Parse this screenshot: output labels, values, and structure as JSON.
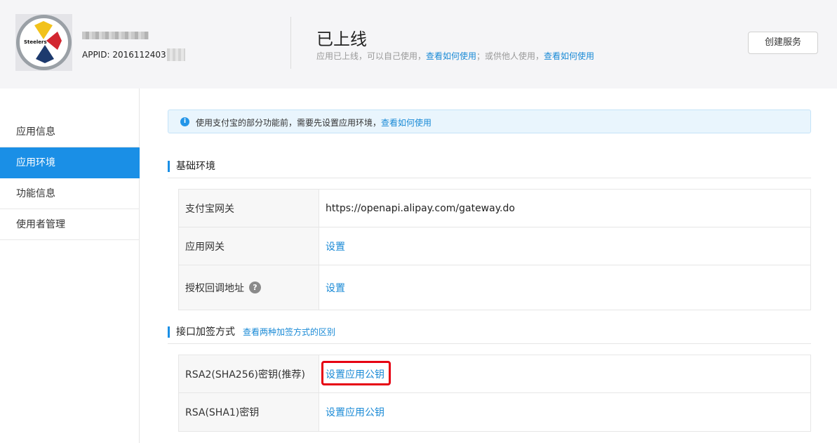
{
  "header": {
    "logo_text": "Steelers",
    "app_id_label": "APPID: 20161124031",
    "status_title": "已上线",
    "status_desc_pre": "应用已上线，可以自己使用，",
    "status_desc_link1": "查看如何使用",
    "status_desc_mid": "；或供他人使用，",
    "status_desc_link2": "查看如何使用",
    "create_button": "创建服务"
  },
  "sidebar": {
    "items": [
      {
        "label": "应用信息",
        "active": false
      },
      {
        "label": "应用环境",
        "active": true
      },
      {
        "label": "功能信息",
        "active": false
      },
      {
        "label": "使用者管理",
        "active": false
      }
    ]
  },
  "notice": {
    "icon": "info-icon",
    "text": "使用支付宝的部分功能前，需要先设置应用环境，",
    "link": "查看如何使用"
  },
  "basic_env": {
    "title": "基础环境",
    "rows": [
      {
        "label": "支付宝网关",
        "value": "https://openapi.alipay.com/gateway.do"
      },
      {
        "label": "应用网关",
        "value": "设置"
      },
      {
        "label": "授权回调地址",
        "help": "?",
        "value": "设置"
      }
    ]
  },
  "signing": {
    "title": "接口加签方式",
    "link": "查看两种加签方式的区别",
    "rows": [
      {
        "label": "RSA2(SHA256)密钥(推荐)",
        "value": "设置应用公钥"
      },
      {
        "label": "RSA(SHA1)密钥",
        "value": "设置应用公钥"
      }
    ]
  },
  "colors": {
    "accent": "#1a8fe6",
    "link": "#1a8ad6",
    "highlight": "#e60012"
  }
}
